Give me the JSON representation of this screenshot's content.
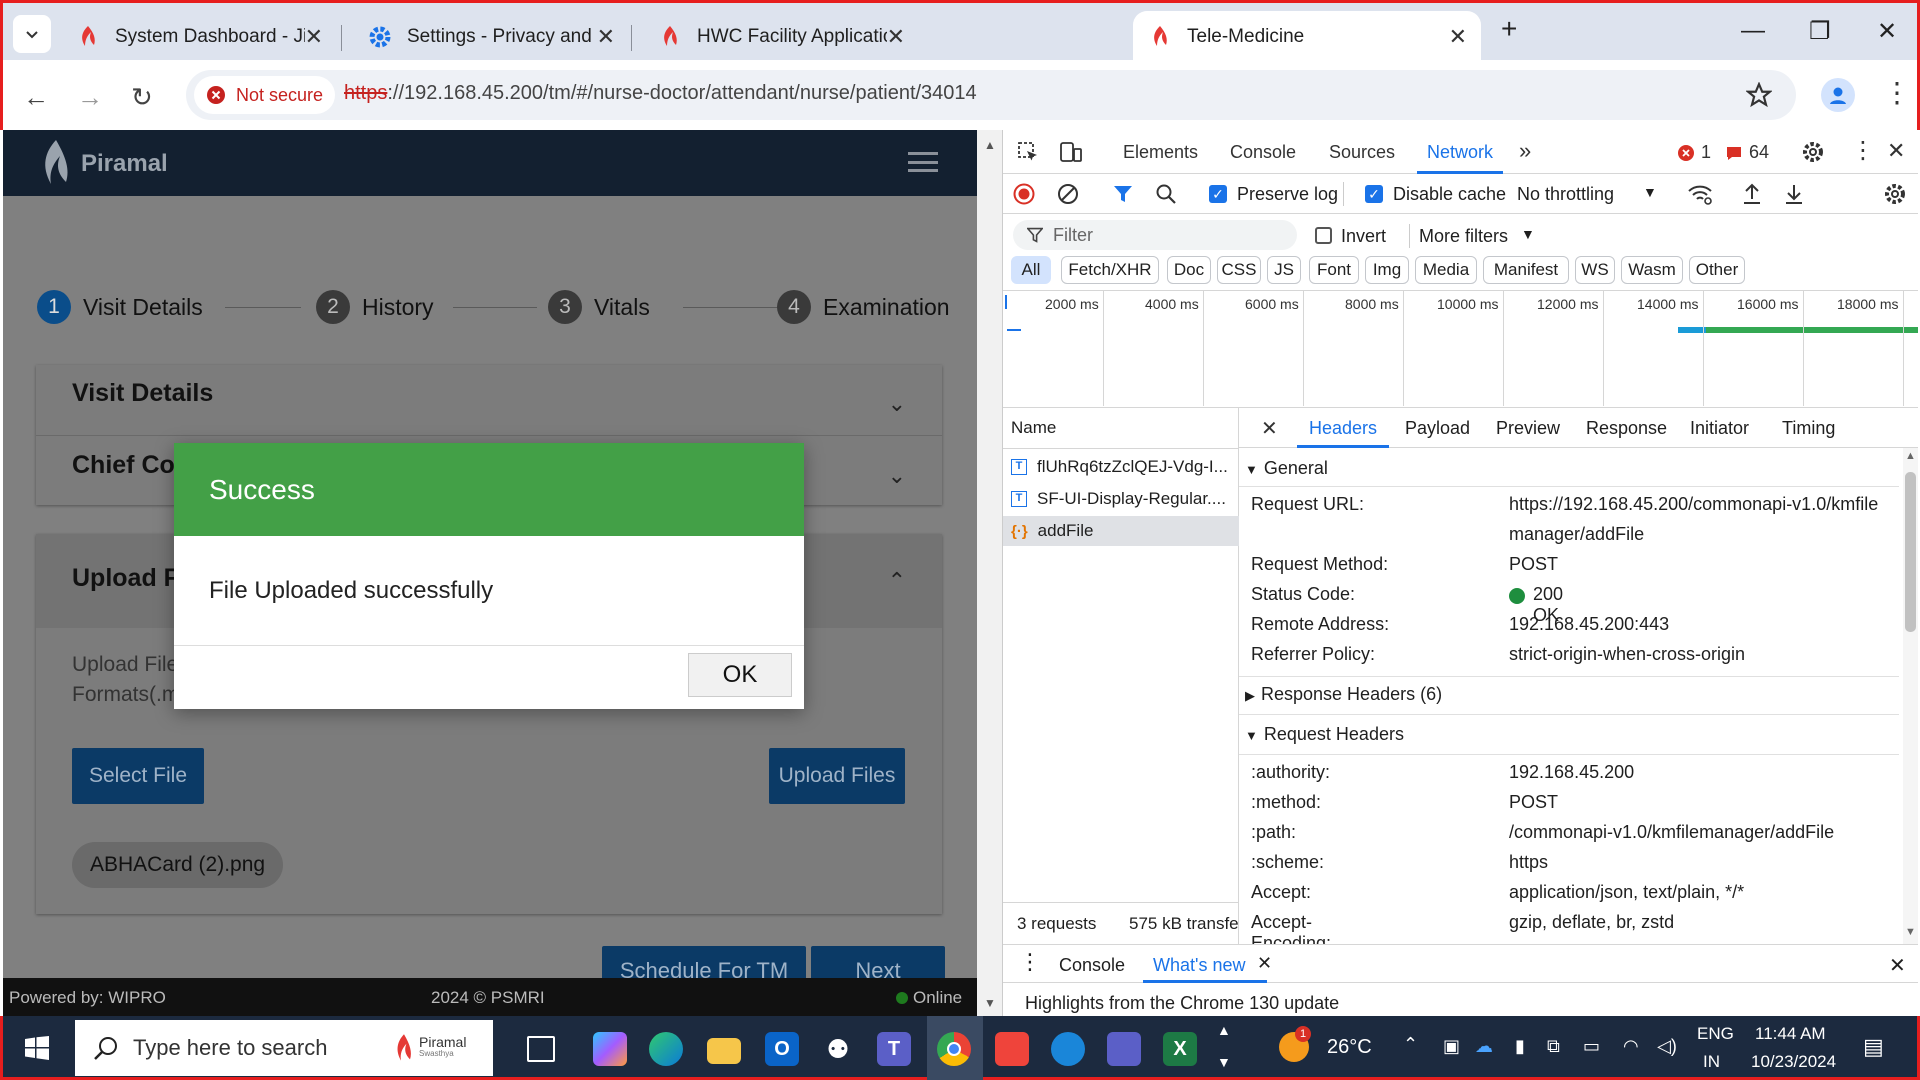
{
  "browser": {
    "tabs": [
      {
        "title": "System Dashboard - Jira",
        "icon": "piramal-logo-icon",
        "active": false
      },
      {
        "title": "Settings - Privacy and security",
        "icon": "gear-icon",
        "active": false
      },
      {
        "title": "HWC Facility Application",
        "icon": "piramal-logo-icon",
        "active": false
      },
      {
        "title": "Tele-Medicine",
        "icon": "piramal-logo-icon",
        "active": true
      }
    ],
    "security_label": "Not secure",
    "url_scheme": "https",
    "url_rest": "://192.168.45.200/tm/#/nurse-doctor/attendant/nurse/patient/34014"
  },
  "app": {
    "brand": "Piramal",
    "steps": [
      {
        "num": "1",
        "label": "Visit Details"
      },
      {
        "num": "2",
        "label": "History"
      },
      {
        "num": "3",
        "label": "Vitals"
      },
      {
        "num": "4",
        "label": "Examination"
      }
    ],
    "panels": {
      "visit_details": "Visit Details",
      "chief_complaints": "Chief Co",
      "upload": "Upload F"
    },
    "upload_hint_line1": "Upload File",
    "upload_hint_line2": "Formats(.m",
    "select_file": "Select File",
    "upload_files": "Upload Files",
    "file_chip": "ABHACard (2).png",
    "schedule_btn": "Schedule For TM",
    "next_btn": "Next",
    "footer_left": "Powered by: WIPRO",
    "footer_center": "2024 © PSMRI",
    "footer_status": "Online"
  },
  "modal": {
    "title": "Success",
    "message": "File Uploaded successfully",
    "ok": "OK"
  },
  "devtools": {
    "tabs": [
      "Elements",
      "Console",
      "Sources",
      "Network"
    ],
    "active_tab": "Network",
    "error_count": "1",
    "issue_count": "64",
    "preserve_log": "Preserve log",
    "disable_cache": "Disable cache",
    "throttling": "No throttling",
    "filter_placeholder": "Filter",
    "invert": "Invert",
    "more_filters": "More filters",
    "filter_chips": [
      "All",
      "Fetch/XHR",
      "Doc",
      "CSS",
      "JS",
      "Font",
      "Img",
      "Media",
      "Manifest",
      "WS",
      "Wasm",
      "Other"
    ],
    "timeline_ticks": [
      "2000 ms",
      "4000 ms",
      "6000 ms",
      "8000 ms",
      "10000 ms",
      "12000 ms",
      "14000 ms",
      "16000 ms",
      "18000 ms"
    ],
    "name_header": "Name",
    "requests": [
      {
        "name": "flUhRq6tzZclQEJ-Vdg-I...",
        "icon": "font-file-icon"
      },
      {
        "name": "SF-UI-Display-Regular....",
        "icon": "font-file-icon"
      },
      {
        "name": "addFile",
        "icon": "xhr-icon"
      }
    ],
    "detail_tabs": [
      "Headers",
      "Payload",
      "Preview",
      "Response",
      "Initiator",
      "Timing"
    ],
    "general_label": "General",
    "general": [
      {
        "key": "Request URL:",
        "value": "https://192.168.45.200/commonapi-v1.0/kmfile",
        "value2": "manager/addFile"
      },
      {
        "key": "Request Method:",
        "value": "POST"
      },
      {
        "key": "Status Code:",
        "value": "200 OK"
      },
      {
        "key": "Remote Address:",
        "value": "192.168.45.200:443"
      },
      {
        "key": "Referrer Policy:",
        "value": "strict-origin-when-cross-origin"
      }
    ],
    "response_headers_label": "Response Headers (6)",
    "request_headers_label": "Request Headers",
    "request_headers": [
      {
        "key": ":authority:",
        "value": "192.168.45.200"
      },
      {
        "key": ":method:",
        "value": "POST"
      },
      {
        "key": ":path:",
        "value": "/commonapi-v1.0/kmfilemanager/addFile"
      },
      {
        "key": ":scheme:",
        "value": "https"
      },
      {
        "key": "Accept:",
        "value": "application/json, text/plain, */*"
      },
      {
        "key": "Accept-Encoding:",
        "value": "gzip, deflate, br, zstd"
      }
    ],
    "status_requests": "3 requests",
    "status_transfer": "575 kB transfe",
    "drawer_tabs": [
      "Console",
      "What's new"
    ],
    "drawer_text": "Highlights from the Chrome 130 update"
  },
  "taskbar": {
    "search_placeholder": "Type here to search",
    "search_brand": "Piramal",
    "search_brand_sub": "Swasthya",
    "weather_temp": "26°C",
    "weather_badge": "1",
    "lang1": "ENG",
    "lang2": "IN",
    "time": "11:44 AM",
    "date": "10/23/2024"
  },
  "colors": {
    "success_green": "#43a047",
    "app_header": "#132030",
    "primary_blue": "#0b3a66",
    "devtools_blue": "#1a73e8",
    "frame_red": "#e61e1e"
  }
}
